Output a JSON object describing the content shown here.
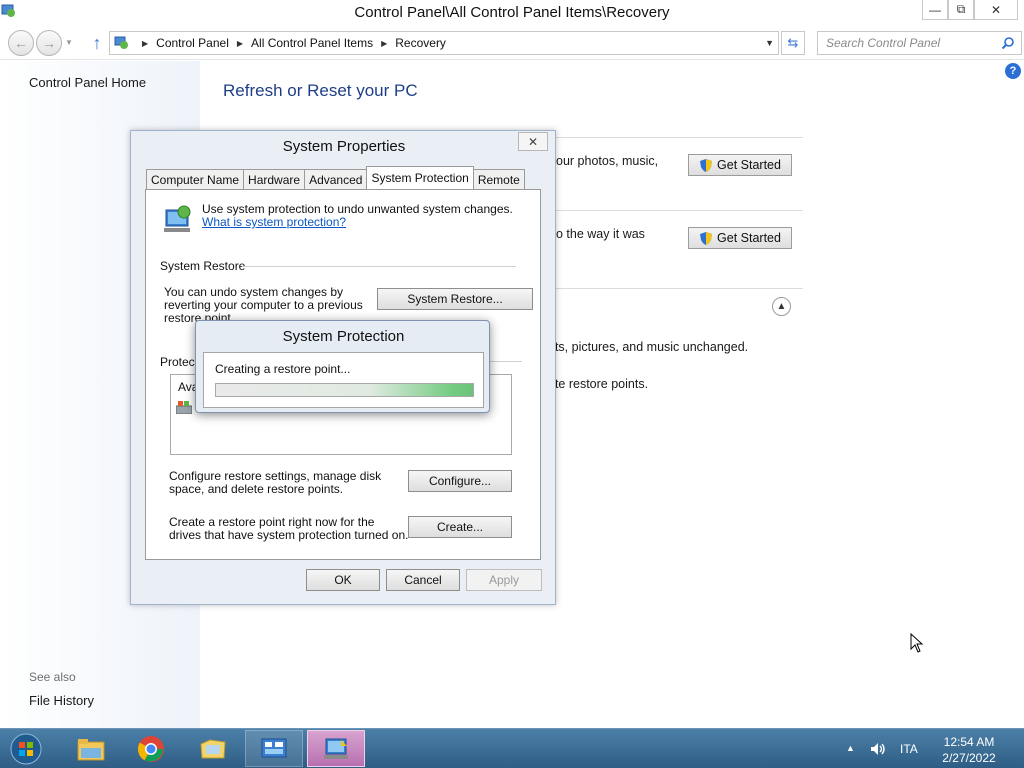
{
  "window": {
    "title": "Control Panel\\All Control Panel Items\\Recovery",
    "minimize_label": "▭",
    "maximize_label": "⧉",
    "close_label": "✕"
  },
  "address_bar": {
    "crumbs": [
      "Control Panel",
      "All Control Panel Items",
      "Recovery"
    ],
    "search_placeholder": "Search Control Panel"
  },
  "left_pane": {
    "home_link": "Control Panel Home",
    "see_also_label": "See also",
    "file_history_link": "File History"
  },
  "main": {
    "title": "Refresh or Reset your PC",
    "row1_text": "our photos, music,",
    "row2_text": "o the way it was",
    "row3_text": "nts, pictures, and music unchanged.",
    "row4_text": "ete restore points.",
    "get_started_label": "Get Started",
    "help_label": "?"
  },
  "system_properties": {
    "title": "System Properties",
    "close_label": "✕",
    "tabs": [
      "Computer Name",
      "Hardware",
      "Advanced",
      "System Protection",
      "Remote"
    ],
    "active_tab": "System Protection",
    "intro_text": "Use system protection to undo unwanted system changes.",
    "intro_link": "What is system protection?",
    "system_restore_label": "System Restore",
    "system_restore_text": "You can undo system changes by reverting your computer to a previous restore point.",
    "system_restore_button": "System Restore...",
    "protection_label": "Protecti",
    "list_header": "Ava",
    "configure_text": "Configure restore settings, manage disk space, and delete restore points.",
    "configure_button": "Configure...",
    "create_text": "Create a restore point right now for the drives that have system protection turned on.",
    "create_button": "Create...",
    "ok_button": "OK",
    "cancel_button": "Cancel",
    "apply_button": "Apply"
  },
  "system_protection": {
    "title": "System Protection",
    "message": "Creating a restore point...",
    "progress_fraction": 0.6
  },
  "taskbar": {
    "items": [
      "file-explorer",
      "chrome",
      "folder",
      "control-panel",
      "system-properties"
    ],
    "language": "ITA",
    "time": "12:54 AM",
    "date": "2/27/2022"
  },
  "colors": {
    "title_blue": "#1e3f87",
    "link_blue": "#0b57c5",
    "progress_green": "#26b83c",
    "taskbar_blue": "#2e5d85"
  }
}
